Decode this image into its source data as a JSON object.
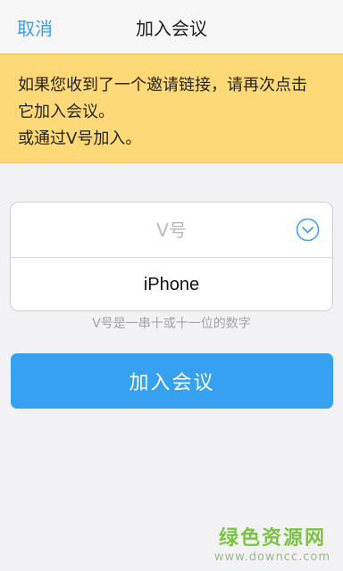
{
  "navbar": {
    "cancel_label": "取消",
    "title": "加入会议"
  },
  "notice": {
    "lines": [
      "如果您收到了一个邀请链接，请再次点击",
      "它加入会议。",
      "或通过V号加入。"
    ]
  },
  "form": {
    "vnumber": {
      "placeholder": "V号",
      "value": ""
    },
    "dropdown_icon": "chevron-down-circle",
    "name": {
      "value": "iPhone"
    },
    "hint": "V号是一串十或十一位的数字"
  },
  "join_button": {
    "label": "加入会议"
  },
  "watermark": {
    "title": "绿色资源网",
    "url": "www.downcc.com"
  },
  "colors": {
    "accent": "#36a1f0",
    "link": "#3a9cf2",
    "notice_bg": "#fdd977",
    "background": "#f2f2f4"
  }
}
